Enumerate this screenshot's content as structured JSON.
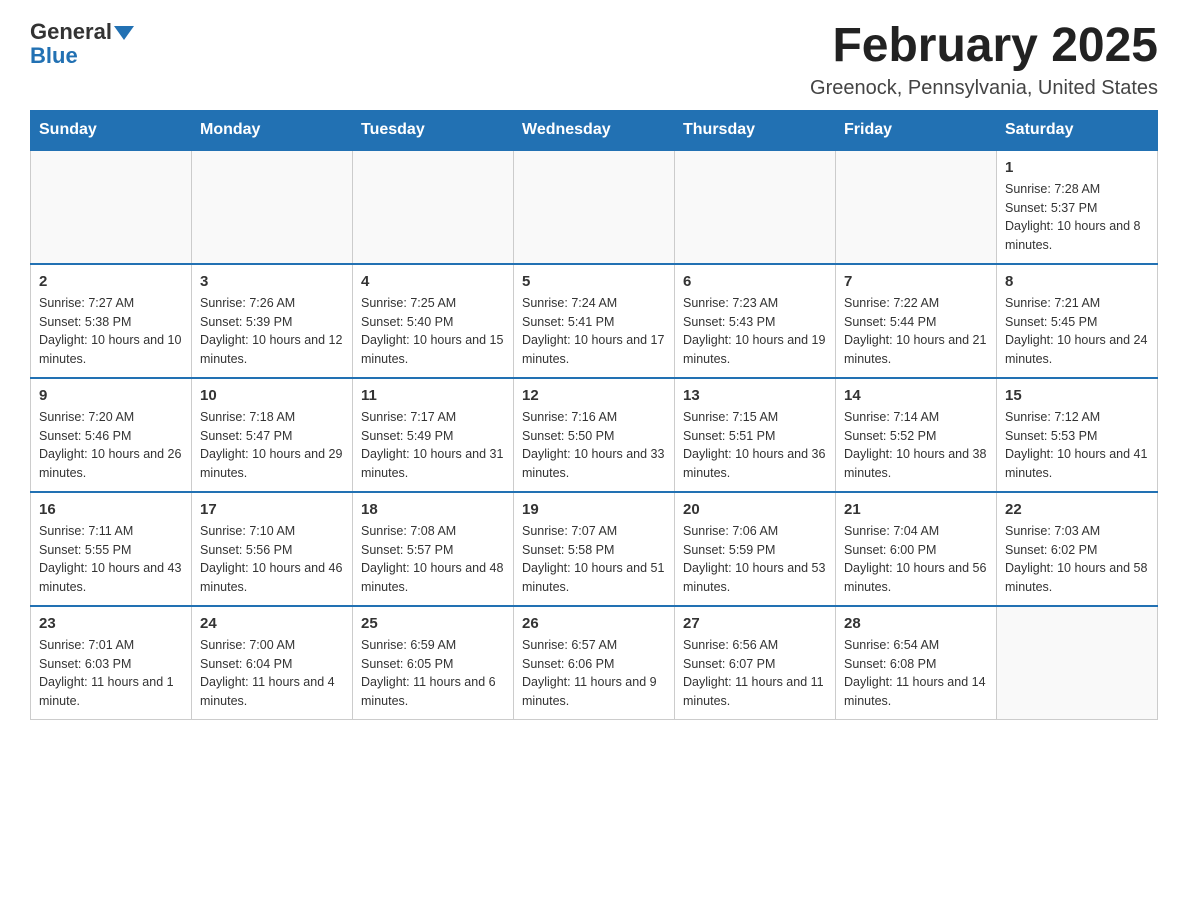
{
  "logo": {
    "general": "General",
    "blue": "Blue"
  },
  "header": {
    "month_title": "February 2025",
    "location": "Greenock, Pennsylvania, United States"
  },
  "days_of_week": [
    "Sunday",
    "Monday",
    "Tuesday",
    "Wednesday",
    "Thursday",
    "Friday",
    "Saturday"
  ],
  "weeks": [
    [
      {
        "day": "",
        "info": ""
      },
      {
        "day": "",
        "info": ""
      },
      {
        "day": "",
        "info": ""
      },
      {
        "day": "",
        "info": ""
      },
      {
        "day": "",
        "info": ""
      },
      {
        "day": "",
        "info": ""
      },
      {
        "day": "1",
        "info": "Sunrise: 7:28 AM\nSunset: 5:37 PM\nDaylight: 10 hours and 8 minutes."
      }
    ],
    [
      {
        "day": "2",
        "info": "Sunrise: 7:27 AM\nSunset: 5:38 PM\nDaylight: 10 hours and 10 minutes."
      },
      {
        "day": "3",
        "info": "Sunrise: 7:26 AM\nSunset: 5:39 PM\nDaylight: 10 hours and 12 minutes."
      },
      {
        "day": "4",
        "info": "Sunrise: 7:25 AM\nSunset: 5:40 PM\nDaylight: 10 hours and 15 minutes."
      },
      {
        "day": "5",
        "info": "Sunrise: 7:24 AM\nSunset: 5:41 PM\nDaylight: 10 hours and 17 minutes."
      },
      {
        "day": "6",
        "info": "Sunrise: 7:23 AM\nSunset: 5:43 PM\nDaylight: 10 hours and 19 minutes."
      },
      {
        "day": "7",
        "info": "Sunrise: 7:22 AM\nSunset: 5:44 PM\nDaylight: 10 hours and 21 minutes."
      },
      {
        "day": "8",
        "info": "Sunrise: 7:21 AM\nSunset: 5:45 PM\nDaylight: 10 hours and 24 minutes."
      }
    ],
    [
      {
        "day": "9",
        "info": "Sunrise: 7:20 AM\nSunset: 5:46 PM\nDaylight: 10 hours and 26 minutes."
      },
      {
        "day": "10",
        "info": "Sunrise: 7:18 AM\nSunset: 5:47 PM\nDaylight: 10 hours and 29 minutes."
      },
      {
        "day": "11",
        "info": "Sunrise: 7:17 AM\nSunset: 5:49 PM\nDaylight: 10 hours and 31 minutes."
      },
      {
        "day": "12",
        "info": "Sunrise: 7:16 AM\nSunset: 5:50 PM\nDaylight: 10 hours and 33 minutes."
      },
      {
        "day": "13",
        "info": "Sunrise: 7:15 AM\nSunset: 5:51 PM\nDaylight: 10 hours and 36 minutes."
      },
      {
        "day": "14",
        "info": "Sunrise: 7:14 AM\nSunset: 5:52 PM\nDaylight: 10 hours and 38 minutes."
      },
      {
        "day": "15",
        "info": "Sunrise: 7:12 AM\nSunset: 5:53 PM\nDaylight: 10 hours and 41 minutes."
      }
    ],
    [
      {
        "day": "16",
        "info": "Sunrise: 7:11 AM\nSunset: 5:55 PM\nDaylight: 10 hours and 43 minutes."
      },
      {
        "day": "17",
        "info": "Sunrise: 7:10 AM\nSunset: 5:56 PM\nDaylight: 10 hours and 46 minutes."
      },
      {
        "day": "18",
        "info": "Sunrise: 7:08 AM\nSunset: 5:57 PM\nDaylight: 10 hours and 48 minutes."
      },
      {
        "day": "19",
        "info": "Sunrise: 7:07 AM\nSunset: 5:58 PM\nDaylight: 10 hours and 51 minutes."
      },
      {
        "day": "20",
        "info": "Sunrise: 7:06 AM\nSunset: 5:59 PM\nDaylight: 10 hours and 53 minutes."
      },
      {
        "day": "21",
        "info": "Sunrise: 7:04 AM\nSunset: 6:00 PM\nDaylight: 10 hours and 56 minutes."
      },
      {
        "day": "22",
        "info": "Sunrise: 7:03 AM\nSunset: 6:02 PM\nDaylight: 10 hours and 58 minutes."
      }
    ],
    [
      {
        "day": "23",
        "info": "Sunrise: 7:01 AM\nSunset: 6:03 PM\nDaylight: 11 hours and 1 minute."
      },
      {
        "day": "24",
        "info": "Sunrise: 7:00 AM\nSunset: 6:04 PM\nDaylight: 11 hours and 4 minutes."
      },
      {
        "day": "25",
        "info": "Sunrise: 6:59 AM\nSunset: 6:05 PM\nDaylight: 11 hours and 6 minutes."
      },
      {
        "day": "26",
        "info": "Sunrise: 6:57 AM\nSunset: 6:06 PM\nDaylight: 11 hours and 9 minutes."
      },
      {
        "day": "27",
        "info": "Sunrise: 6:56 AM\nSunset: 6:07 PM\nDaylight: 11 hours and 11 minutes."
      },
      {
        "day": "28",
        "info": "Sunrise: 6:54 AM\nSunset: 6:08 PM\nDaylight: 11 hours and 14 minutes."
      },
      {
        "day": "",
        "info": ""
      }
    ]
  ]
}
